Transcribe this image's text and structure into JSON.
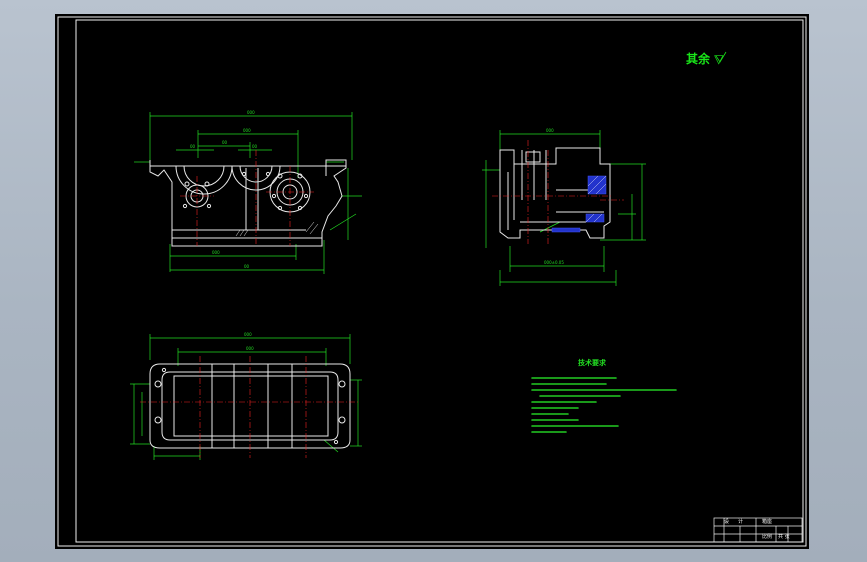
{
  "title_block": {
    "cell_1": "设",
    "cell_2": "计",
    "cell_3": "箱座",
    "cell_4": "比例",
    "cell_5": "共 张"
  },
  "annotations": {
    "surface_finish": "其余 ▽",
    "tech_requirements_title": "技术要求"
  },
  "colors": {
    "frame": "#f0f0f0",
    "outline": "#e8e8e8",
    "dimension": "#22dd22",
    "centerline": "#ee2222",
    "hatch": "#2233cc",
    "annotation_text": "#22dd22"
  }
}
